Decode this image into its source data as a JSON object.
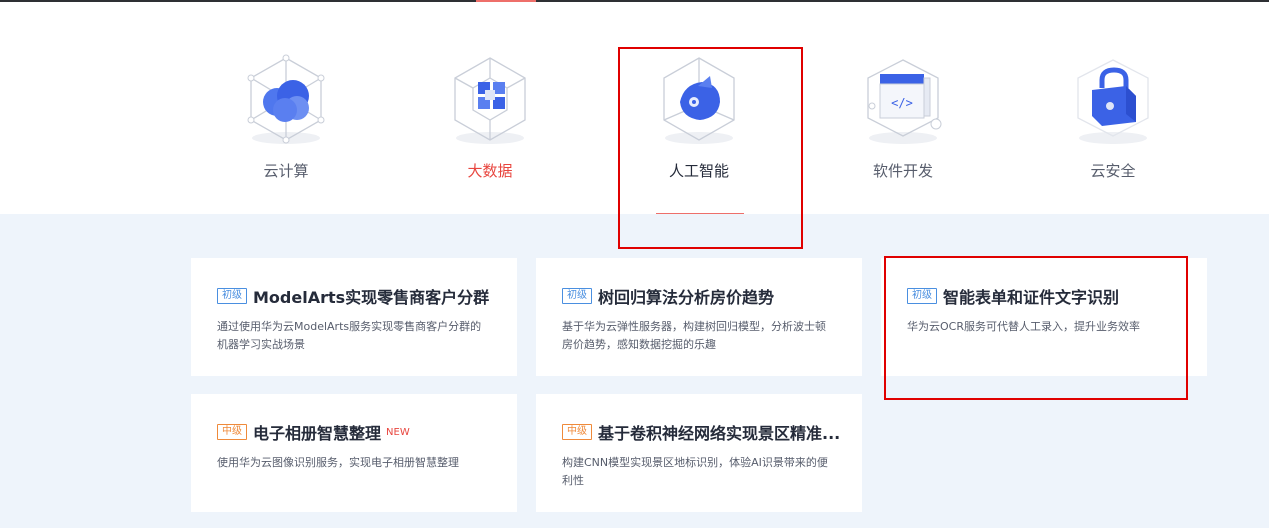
{
  "categories": [
    {
      "label": "云计算",
      "icon": "cloud-computing-icon"
    },
    {
      "label": "大数据",
      "icon": "big-data-icon"
    },
    {
      "label": "人工智能",
      "icon": "ai-robot-icon"
    },
    {
      "label": "软件开发",
      "icon": "code-window-icon"
    },
    {
      "label": "云安全",
      "icon": "security-lock-icon"
    }
  ],
  "colors": {
    "accent": "#ee6f6a",
    "highlight_box": "#e00000",
    "panel_bg": "#eef4fb",
    "level_basic": "#4a8fe0",
    "level_mid": "#ef8a3a"
  },
  "cards": [
    {
      "level": "初级",
      "title": "ModelArts实现零售商客户分群",
      "desc": "通过使用华为云ModelArts服务实现零售商客户分群的机器学习实战场景"
    },
    {
      "level": "初级",
      "title": "树回归算法分析房价趋势",
      "desc": "基于华为云弹性服务器，构建树回归模型，分析波士顿房价趋势，感知数据挖掘的乐趣"
    },
    {
      "level": "初级",
      "title": "智能表单和证件文字识别",
      "desc": "华为云OCR服务可代替人工录入，提升业务效率"
    },
    {
      "level": "中级",
      "title": "电子相册智慧整理",
      "new": "NEW",
      "desc": "使用华为云图像识别服务，实现电子相册智慧整理"
    },
    {
      "level": "中级",
      "title": "基于卷积神经网络实现景区精准...",
      "desc": "构建CNN模型实现景区地标识别，体验AI识景带来的便利性"
    }
  ]
}
